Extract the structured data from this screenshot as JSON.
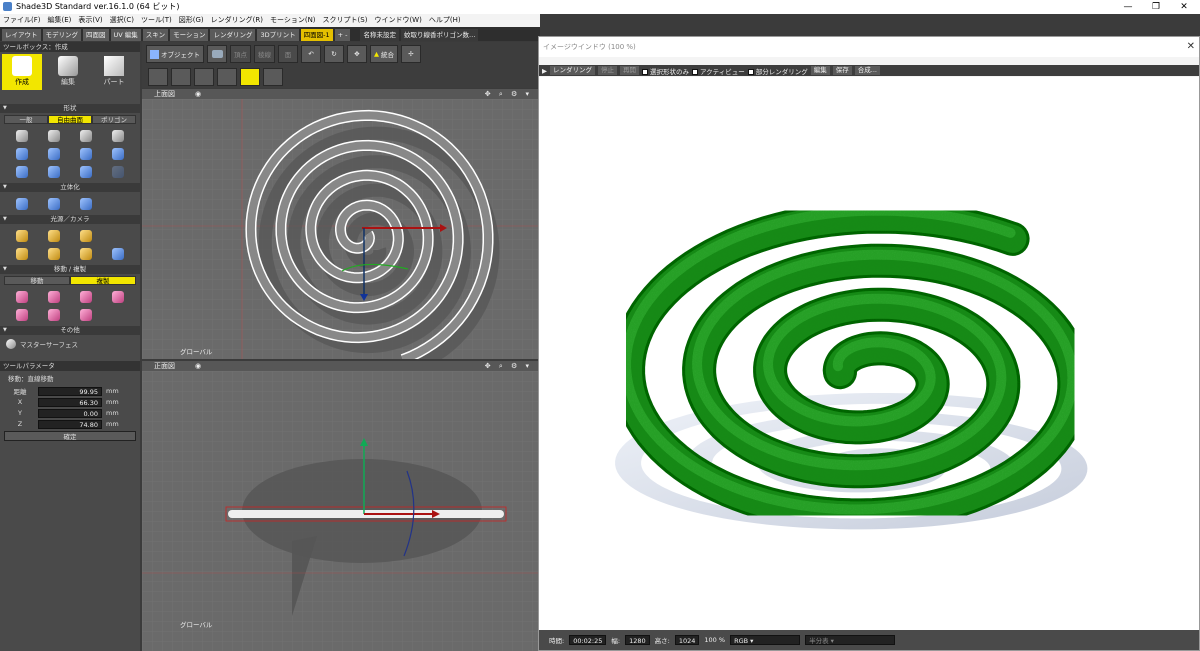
{
  "app": {
    "title": "Shade3D Standard ver.16.1.0 (64 ビット)",
    "window_buttons": [
      "—",
      "❐",
      "✕"
    ]
  },
  "menu": [
    "ファイル(F)",
    "編集(E)",
    "表示(V)",
    "選択(C)",
    "ツール(T)",
    "図形(G)",
    "レンダリング(R)",
    "モーション(N)",
    "スクリプト(S)",
    "ウインドウ(W)",
    "ヘルプ(H)"
  ],
  "tabs": [
    {
      "label": "レイアウト",
      "state": "normal"
    },
    {
      "label": "モデリング",
      "state": "normal"
    },
    {
      "label": "四面図",
      "state": "normal"
    },
    {
      "label": "UV 編集",
      "state": "normal"
    },
    {
      "label": "スキン",
      "state": "normal"
    },
    {
      "label": "モーション",
      "state": "normal"
    },
    {
      "label": "レンダリング",
      "state": "normal"
    },
    {
      "label": "3Dプリント",
      "state": "normal"
    },
    {
      "label": "四面図-1",
      "state": "active"
    },
    {
      "label": "+ -",
      "state": "normal"
    },
    {
      "label": "名称未設定",
      "state": "dark"
    },
    {
      "label": "蚊取り線香ポリゴン数…",
      "state": "dark"
    }
  ],
  "toolbox": {
    "title": "ツールボックス：作成",
    "modes": [
      "作成",
      "編集",
      "パート"
    ],
    "shape_section": "形状",
    "shape_tabs": [
      {
        "label": "一般",
        "active": false
      },
      {
        "label": "自由曲面",
        "active": true
      },
      {
        "label": "ポリゴン",
        "active": false
      }
    ],
    "solidify_section": "立体化",
    "light_section": "光源／カメラ",
    "move_section": "移動 / 複製",
    "move_tabs": [
      {
        "label": "移動",
        "active": false
      },
      {
        "label": "複製",
        "active": true
      }
    ],
    "other_section": "その他",
    "master_surface": "マスターサーフェス"
  },
  "tool_params": {
    "title": "ツールパラメータ",
    "subtitle": "移動：直線移動",
    "rows": [
      {
        "label": "距離",
        "value": "99.95",
        "unit": "mm"
      },
      {
        "label": "X",
        "value": "66.30",
        "unit": "mm"
      },
      {
        "label": "Y",
        "value": "0.00",
        "unit": "mm"
      },
      {
        "label": "Z",
        "value": "74.80",
        "unit": "mm"
      }
    ],
    "confirm": "確定"
  },
  "main_toolbar": {
    "object": "オブジェクト",
    "vertex": "頂点",
    "edge": "稜線",
    "face": "面",
    "merge": "統合"
  },
  "views": {
    "top": "上面図",
    "front": "正面図",
    "global": "グローバル",
    "icons": "✥ ⌕ ⚙ ▾"
  },
  "image_window": {
    "title": "イメージウインドウ (100 %)",
    "buttons": {
      "render": "レンダリング",
      "stop": "停止",
      "resume": "再開",
      "edit": "編集",
      "save": "保存",
      "compose": "合成..."
    },
    "checks": [
      "選択形状のみ",
      "アクティビュー",
      "部分レンダリング"
    ],
    "status": {
      "time_label": "時間:",
      "time": "00:02:25",
      "width_label": "幅:",
      "width": "1280",
      "height_label": "高さ:",
      "height": "1024",
      "zoom": "100 %",
      "mode": "RGB",
      "mode2": "半分表"
    }
  },
  "colors": {
    "accent": "#f2e600",
    "coil": "#1a8a1a",
    "viewport": "#6a6a6a"
  }
}
